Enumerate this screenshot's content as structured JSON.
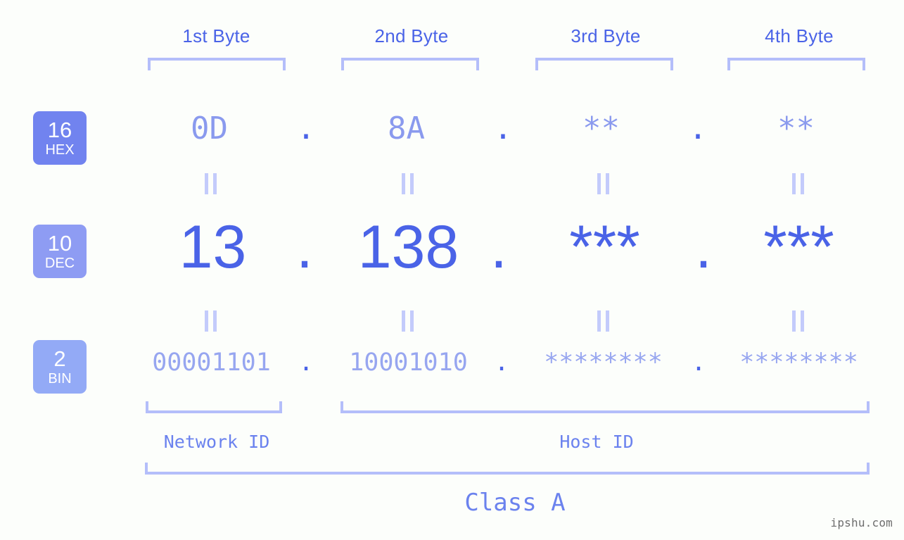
{
  "page": {
    "background_color": "#fcfefb",
    "accent_color": "#4a63e7",
    "muted_accent_color": "#b4befa",
    "watermark": "ipshu.com"
  },
  "byte_headers": [
    {
      "label": "1st Byte"
    },
    {
      "label": "2nd Byte"
    },
    {
      "label": "3rd Byte"
    },
    {
      "label": "4th Byte"
    }
  ],
  "rows": [
    {
      "base_number": "16",
      "base_name": "HEX",
      "badge_color": "#7183ef",
      "values": [
        "0D",
        "8A",
        "**",
        "**"
      ],
      "separator": "."
    },
    {
      "base_number": "10",
      "base_name": "DEC",
      "badge_color": "#8e9cf3",
      "values": [
        "13",
        "138",
        "***",
        "***"
      ],
      "separator": "."
    },
    {
      "base_number": "2",
      "base_name": "BIN",
      "badge_color": "#93aaf6",
      "values": [
        "00001101",
        "10001010",
        "********",
        "********"
      ],
      "separator": "."
    }
  ],
  "id_spans": [
    {
      "label": "Network ID"
    },
    {
      "label": "Host ID"
    }
  ],
  "class": {
    "label": "Class A"
  }
}
